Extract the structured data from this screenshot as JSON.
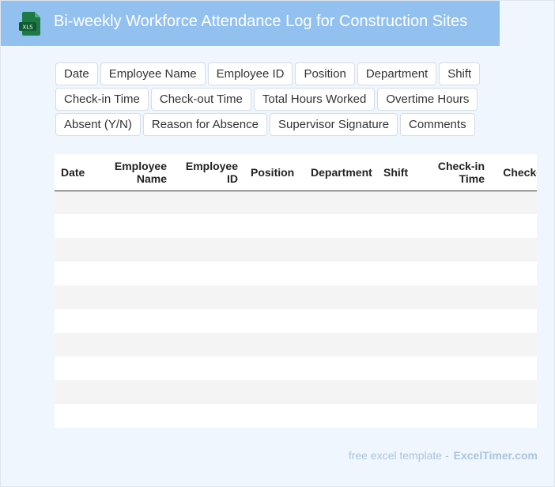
{
  "header": {
    "title": "Bi-weekly Workforce Attendance Log for Construction Sites",
    "icon_label": "XLS",
    "icon": "xls-file-icon",
    "background": "#92c0ef"
  },
  "tags": [
    "Date",
    "Employee Name",
    "Employee ID",
    "Position",
    "Department",
    "Shift",
    "Check-in Time",
    "Check-out Time",
    "Total Hours Worked",
    "Overtime Hours",
    "Absent (Y/N)",
    "Reason for Absence",
    "Supervisor Signature",
    "Comments"
  ],
  "table": {
    "columns": [
      {
        "label": "Date",
        "align": "left"
      },
      {
        "label": "Employee Name",
        "align": "right"
      },
      {
        "label": "Employee ID",
        "align": "right"
      },
      {
        "label": "Position",
        "align": "left"
      },
      {
        "label": "Department",
        "align": "left"
      },
      {
        "label": "Shift",
        "align": "left"
      },
      {
        "label": "Check-in Time",
        "align": "right"
      },
      {
        "label": "Check-out Time",
        "align": "right"
      }
    ],
    "empty_rows": 10
  },
  "footer": {
    "text": "free excel template -",
    "brand": "ExcelTimer.com"
  }
}
